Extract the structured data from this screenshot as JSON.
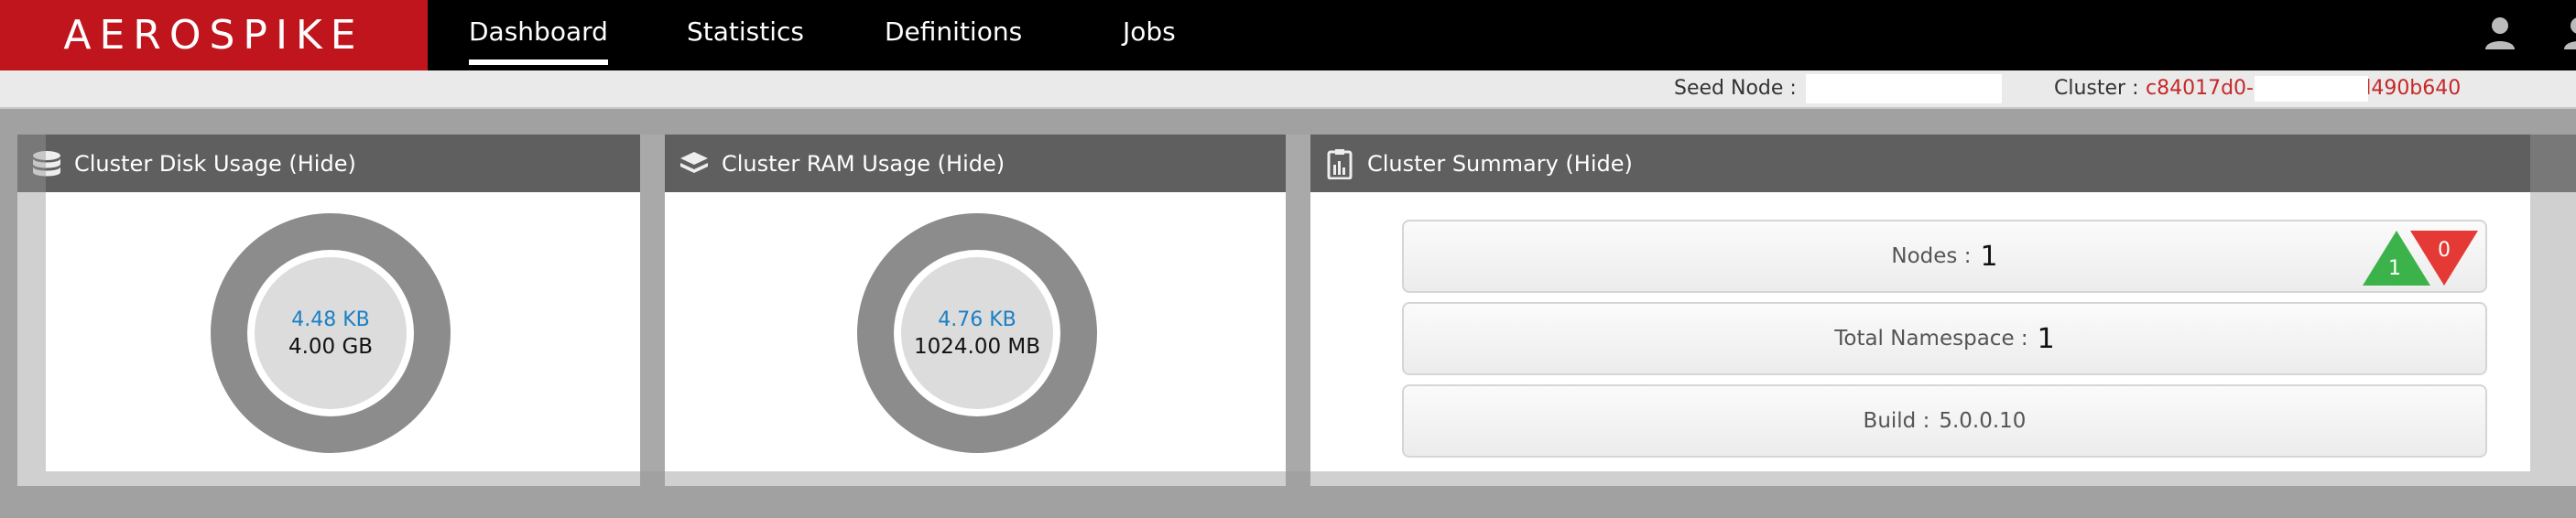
{
  "brand": {
    "logo_text": "AEROSPIKE",
    "accent": "#c0151d"
  },
  "nav": {
    "items": [
      {
        "label": "Dashboard",
        "active": true
      },
      {
        "label": "Statistics",
        "active": false
      },
      {
        "label": "Definitions",
        "active": false
      },
      {
        "label": "Jobs",
        "active": false
      }
    ],
    "user_icon": "user-icon"
  },
  "subbar": {
    "seed_label": "Seed Node :",
    "seed_value": "",
    "cluster_label": "Cluster :",
    "cluster_value": "c84017d0-            b6f5-06f8d490b640"
  },
  "disk": {
    "title": "Cluster Disk Usage (Hide)",
    "icon": "database-icon",
    "used": "4.48 KB",
    "total": "4.00 GB"
  },
  "ram": {
    "title": "Cluster RAM Usage (Hide)",
    "icon": "stack-icon",
    "used": "4.76 KB",
    "total": "1024.00 MB"
  },
  "summary": {
    "title": "Cluster Summary (Hide)",
    "icon": "clipboard-chart-icon",
    "nodes_label": "Nodes :",
    "nodes_value": "1",
    "nodes_up": "1",
    "nodes_down": "0",
    "namespace_label": "Total Namespace :",
    "namespace_value": "1",
    "build_label": "Build :",
    "build_value": "5.0.0.10",
    "up_color": "#3cb34a",
    "down_color": "#e53935"
  }
}
